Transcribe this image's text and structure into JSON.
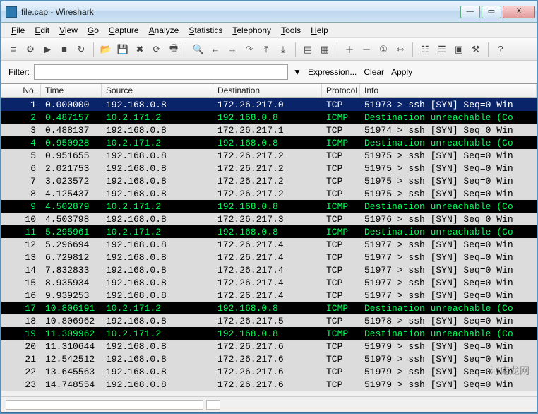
{
  "window": {
    "title": "file.cap - Wireshark",
    "minimize": "—",
    "maximize": "▭",
    "close": "X"
  },
  "menu": {
    "items": [
      {
        "label": "File",
        "u": "F"
      },
      {
        "label": "Edit",
        "u": "E"
      },
      {
        "label": "View",
        "u": "V"
      },
      {
        "label": "Go",
        "u": "G"
      },
      {
        "label": "Capture",
        "u": "C"
      },
      {
        "label": "Analyze",
        "u": "A"
      },
      {
        "label": "Statistics",
        "u": "S"
      },
      {
        "label": "Telephony",
        "u": "T"
      },
      {
        "label": "Tools",
        "u": "T"
      },
      {
        "label": "Help",
        "u": "H"
      }
    ]
  },
  "toolbar": {
    "group1": [
      "list-interfaces",
      "capture-options",
      "start-capture",
      "stop-capture",
      "restart-capture"
    ],
    "group2": [
      "open-file",
      "save-file",
      "close-file",
      "reload",
      "print"
    ],
    "group3": [
      "find",
      "go-back",
      "go-forward",
      "go-to",
      "go-first",
      "go-last"
    ],
    "group4": [
      "colorize",
      "auto-scroll"
    ],
    "group5": [
      "zoom-in",
      "zoom-out",
      "zoom-reset",
      "resize-columns"
    ],
    "group6": [
      "capture-filters",
      "display-filters",
      "coloring-rules",
      "preferences"
    ],
    "group7": [
      "help"
    ]
  },
  "filter": {
    "label": "Filter:",
    "value": "",
    "placeholder": "",
    "expression": "Expression...",
    "clear": "Clear",
    "apply": "Apply"
  },
  "columns": {
    "no": "No.",
    "time": "Time",
    "src": "Source",
    "dst": "Destination",
    "proto": "Protocol",
    "info": "Info"
  },
  "packets": [
    {
      "no": 1,
      "time": "0.000000",
      "src": "192.168.0.8",
      "dst": "172.26.217.0",
      "proto": "TCP",
      "info": "51973 > ssh [SYN] Seq=0 Win",
      "sel": true
    },
    {
      "no": 2,
      "time": "0.487157",
      "src": "10.2.171.2",
      "dst": "192.168.0.8",
      "proto": "ICMP",
      "info": "Destination unreachable (Co",
      "icmp": true
    },
    {
      "no": 3,
      "time": "0.488137",
      "src": "192.168.0.8",
      "dst": "172.26.217.1",
      "proto": "TCP",
      "info": "51974 > ssh [SYN] Seq=0 Win"
    },
    {
      "no": 4,
      "time": "0.950928",
      "src": "10.2.171.2",
      "dst": "192.168.0.8",
      "proto": "ICMP",
      "info": "Destination unreachable (Co",
      "icmp": true
    },
    {
      "no": 5,
      "time": "0.951655",
      "src": "192.168.0.8",
      "dst": "172.26.217.2",
      "proto": "TCP",
      "info": "51975 > ssh [SYN] Seq=0 Win"
    },
    {
      "no": 6,
      "time": "2.021753",
      "src": "192.168.0.8",
      "dst": "172.26.217.2",
      "proto": "TCP",
      "info": "51975 > ssh [SYN] Seq=0 Win"
    },
    {
      "no": 7,
      "time": "3.023572",
      "src": "192.168.0.8",
      "dst": "172.26.217.2",
      "proto": "TCP",
      "info": "51975 > ssh [SYN] Seq=0 Win"
    },
    {
      "no": 8,
      "time": "4.125437",
      "src": "192.168.0.8",
      "dst": "172.26.217.2",
      "proto": "TCP",
      "info": "51975 > ssh [SYN] Seq=0 Win"
    },
    {
      "no": 9,
      "time": "4.502879",
      "src": "10.2.171.2",
      "dst": "192.168.0.8",
      "proto": "ICMP",
      "info": "Destination unreachable (Co",
      "icmp": true
    },
    {
      "no": 10,
      "time": "4.503798",
      "src": "192.168.0.8",
      "dst": "172.26.217.3",
      "proto": "TCP",
      "info": "51976 > ssh [SYN] Seq=0 Win"
    },
    {
      "no": 11,
      "time": "5.295961",
      "src": "10.2.171.2",
      "dst": "192.168.0.8",
      "proto": "ICMP",
      "info": "Destination unreachable (Co",
      "icmp": true
    },
    {
      "no": 12,
      "time": "5.296694",
      "src": "192.168.0.8",
      "dst": "172.26.217.4",
      "proto": "TCP",
      "info": "51977 > ssh [SYN] Seq=0 Win"
    },
    {
      "no": 13,
      "time": "6.729812",
      "src": "192.168.0.8",
      "dst": "172.26.217.4",
      "proto": "TCP",
      "info": "51977 > ssh [SYN] Seq=0 Win"
    },
    {
      "no": 14,
      "time": "7.832833",
      "src": "192.168.0.8",
      "dst": "172.26.217.4",
      "proto": "TCP",
      "info": "51977 > ssh [SYN] Seq=0 Win"
    },
    {
      "no": 15,
      "time": "8.935934",
      "src": "192.168.0.8",
      "dst": "172.26.217.4",
      "proto": "TCP",
      "info": "51977 > ssh [SYN] Seq=0 Win"
    },
    {
      "no": 16,
      "time": "9.939253",
      "src": "192.168.0.8",
      "dst": "172.26.217.4",
      "proto": "TCP",
      "info": "51977 > ssh [SYN] Seq=0 Win"
    },
    {
      "no": 17,
      "time": "10.806191",
      "src": "10.2.171.2",
      "dst": "192.168.0.8",
      "proto": "ICMP",
      "info": "Destination unreachable (Co",
      "icmp": true
    },
    {
      "no": 18,
      "time": "10.806962",
      "src": "192.168.0.8",
      "dst": "172.26.217.5",
      "proto": "TCP",
      "info": "51978 > ssh [SYN] Seq=0 Win"
    },
    {
      "no": 19,
      "time": "11.309962",
      "src": "10.2.171.2",
      "dst": "192.168.0.8",
      "proto": "ICMP",
      "info": "Destination unreachable (Co",
      "icmp": true
    },
    {
      "no": 20,
      "time": "11.310644",
      "src": "192.168.0.8",
      "dst": "172.26.217.6",
      "proto": "TCP",
      "info": "51979 > ssh [SYN] Seq=0 Win"
    },
    {
      "no": 21,
      "time": "12.542512",
      "src": "192.168.0.8",
      "dst": "172.26.217.6",
      "proto": "TCP",
      "info": "51979 > ssh [SYN] Seq=0 Win"
    },
    {
      "no": 22,
      "time": "13.645563",
      "src": "192.168.0.8",
      "dst": "172.26.217.6",
      "proto": "TCP",
      "info": "51979 > ssh [SYN] Seq=0 Win"
    },
    {
      "no": 23,
      "time": "14.748554",
      "src": "192.168.0.8",
      "dst": "172.26.217.6",
      "proto": "TCP",
      "info": "51979 > ssh [SYN] Seq=0 Win"
    }
  ],
  "watermark": "河南龙网"
}
